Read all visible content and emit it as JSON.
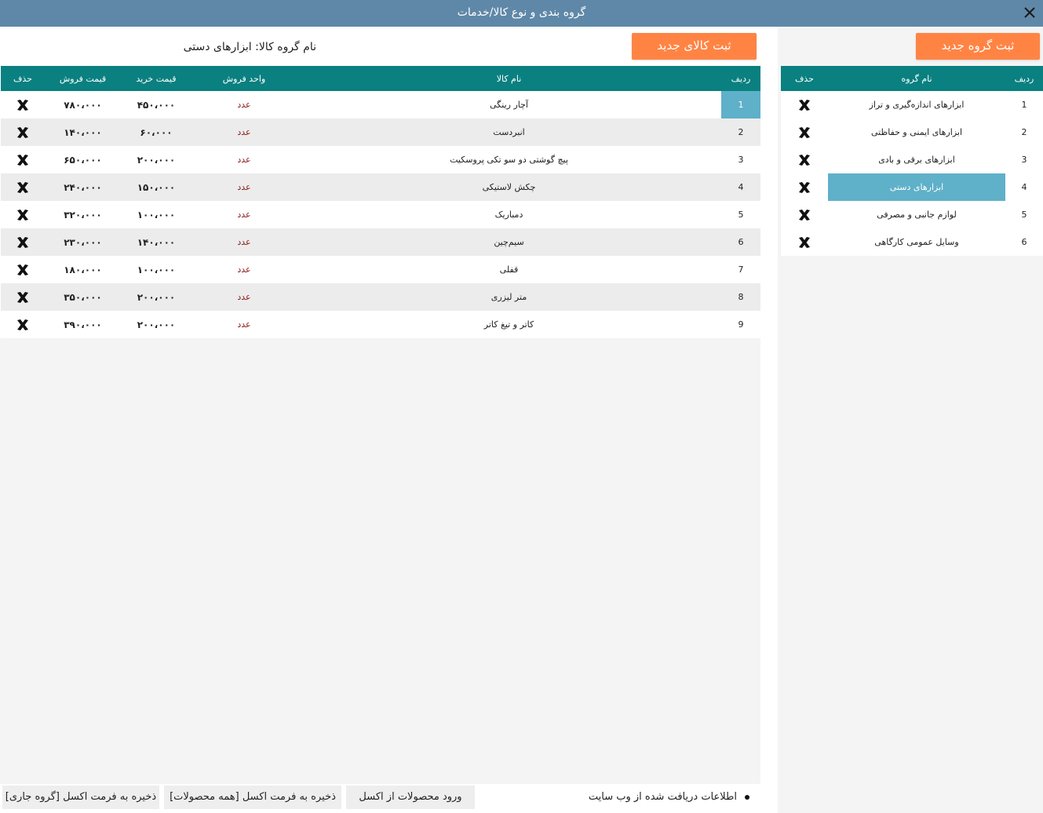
{
  "window": {
    "title": "گروه بندی و نوع کالا/خدمات"
  },
  "groups": {
    "new_button": "ثبت گروه جدید",
    "columns": {
      "row": "ردیف",
      "name": "نام گروه",
      "delete": "حذف"
    },
    "selected_index": 3,
    "rows": [
      {
        "row": "1",
        "name": "ابزارهای اندازه‌گیری و تراز"
      },
      {
        "row": "2",
        "name": "ابزارهای ایمنی و حفاظتی"
      },
      {
        "row": "3",
        "name": "ابزارهای برقی و بادی"
      },
      {
        "row": "4",
        "name": "ابزارهای دستی"
      },
      {
        "row": "5",
        "name": "لوازم جانبی و مصرفی"
      },
      {
        "row": "6",
        "name": "وسایل عمومی کارگاهی"
      }
    ]
  },
  "products": {
    "new_button": "ثبت کالای جدید",
    "group_label": "نام گروه کالا: ابزارهای دستی",
    "columns": {
      "row": "ردیف",
      "name": "نام کالا",
      "unit": "واحد فروش",
      "buy": "قیمت خرید",
      "sell": "قیمت فروش",
      "delete": "حذف"
    },
    "rows": [
      {
        "row": "1",
        "name": "آچار رینگی",
        "unit": "عدد",
        "buy": "۴۵۰،۰۰۰",
        "sell": "۷۸۰،۰۰۰"
      },
      {
        "row": "2",
        "name": "انبردست",
        "unit": "عدد",
        "buy": "۶۰،۰۰۰",
        "sell": "۱۴۰،۰۰۰"
      },
      {
        "row": "3",
        "name": "پیچ گوشتی دو سو تکی پروسکیت",
        "unit": "عدد",
        "buy": "۲۰۰،۰۰۰",
        "sell": "۶۵۰،۰۰۰"
      },
      {
        "row": "4",
        "name": "چکش لاستیکی",
        "unit": "عدد",
        "buy": "۱۵۰،۰۰۰",
        "sell": "۲۴۰،۰۰۰"
      },
      {
        "row": "5",
        "name": "دمباریک",
        "unit": "عدد",
        "buy": "۱۰۰،۰۰۰",
        "sell": "۳۲۰،۰۰۰"
      },
      {
        "row": "6",
        "name": "سیم‌چین",
        "unit": "عدد",
        "buy": "۱۴۰،۰۰۰",
        "sell": "۲۳۰،۰۰۰"
      },
      {
        "row": "7",
        "name": "قفلی",
        "unit": "عدد",
        "buy": "۱۰۰،۰۰۰",
        "sell": "۱۸۰،۰۰۰"
      },
      {
        "row": "8",
        "name": "متر لیزری",
        "unit": "عدد",
        "buy": "۲۰۰،۰۰۰",
        "sell": "۳۵۰،۰۰۰"
      },
      {
        "row": "9",
        "name": "کاتر و تیغ کاتر",
        "unit": "عدد",
        "buy": "۲۰۰،۰۰۰",
        "sell": "۳۹۰،۰۰۰"
      }
    ]
  },
  "footer": {
    "save_current_group": "ذخیره به فرمت اکسل [گروه جاری]",
    "save_all_products": "ذخیره به فرمت اکسل [همه محصولات]",
    "import_excel": "ورود محصولات از اکسل",
    "legend": "اطلاعات دریافت شده از وب سایت"
  },
  "colors": {
    "titlebar": "#5f88a8",
    "header": "#0a8080",
    "accent": "#ff8444",
    "selection": "#5fb0c9",
    "unit_text": "#8b1a1a"
  }
}
